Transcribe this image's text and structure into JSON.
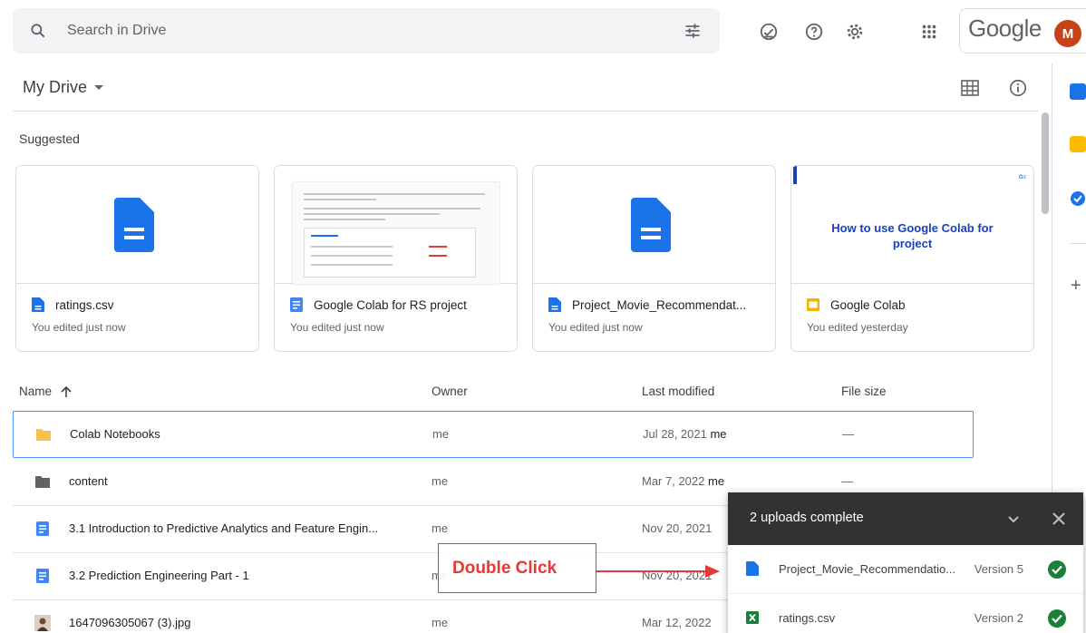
{
  "search": {
    "placeholder": "Search in Drive"
  },
  "brand": {
    "word": "Google",
    "avatar_letter": "M",
    "avatar_color": "#c5421a"
  },
  "header": {
    "title": "My Drive"
  },
  "suggested": {
    "label": "Suggested",
    "cards": [
      {
        "name": "ratings.csv",
        "sub": "You edited just now",
        "icon": "file-doc-icon"
      },
      {
        "name": "Google Colab for RS project",
        "sub": "You edited just now",
        "icon": "google-docs-icon"
      },
      {
        "name": "Project_Movie_Recommendat...",
        "sub": "You edited just now",
        "icon": "file-doc-icon"
      },
      {
        "name": "Google Colab",
        "sub": "You edited yesterday",
        "icon": "google-slides-icon"
      }
    ],
    "slides_preview_title": "How to use Google Colab for project"
  },
  "table": {
    "columns": {
      "name": "Name",
      "owner": "Owner",
      "modified": "Last modified",
      "size": "File size"
    },
    "rows": [
      {
        "name": "Colab Notebooks",
        "owner": "me",
        "date": "Jul 28, 2021",
        "by": "me",
        "size": "—",
        "icon": "folder-yellow-icon"
      },
      {
        "name": "content",
        "owner": "me",
        "date": "Mar 7, 2022",
        "by": "me",
        "size": "—",
        "icon": "folder-icon"
      },
      {
        "name": "3.1 Introduction to Predictive Analytics and Feature Engin...",
        "owner": "me",
        "date": "Nov 20, 2021",
        "by": "",
        "size": "",
        "icon": "google-docs-icon"
      },
      {
        "name": "3.2 Prediction Engineering Part - 1",
        "owner": "me",
        "date": "Nov 20, 2021",
        "by": "",
        "size": "",
        "icon": "google-docs-icon"
      },
      {
        "name": "1647096305067 (3).jpg",
        "owner": "me",
        "date": "Mar 12, 2022",
        "by": "",
        "size": "",
        "icon": "image-thumbnail-icon"
      }
    ]
  },
  "uploads": {
    "title": "2 uploads complete",
    "items": [
      {
        "name": "Project_Movie_Recommendatio...",
        "version": "Version 5",
        "icon": "file-doc-icon"
      },
      {
        "name": "ratings.csv",
        "version": "Version 2",
        "icon": "sheets-icon"
      }
    ]
  },
  "annotation": {
    "label": "Double Click",
    "color": "#e53935"
  },
  "colors": {
    "accent": "#1a73e8",
    "selection": "#4d90fe",
    "success": "#188038"
  }
}
